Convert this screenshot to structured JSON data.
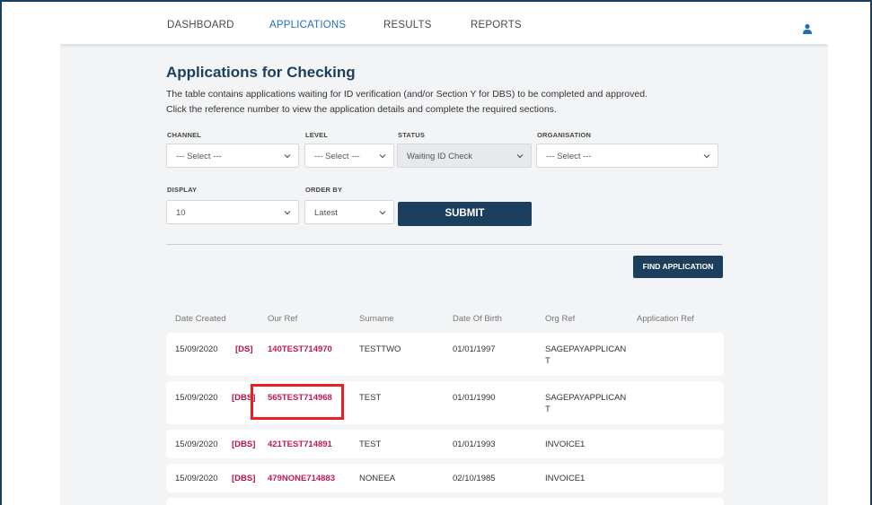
{
  "nav": {
    "items": [
      "DASHBOARD",
      "APPLICATIONS",
      "RESULTS",
      "REPORTS"
    ],
    "active": "APPLICATIONS"
  },
  "page": {
    "title": "Applications for Checking",
    "description_line1": "The table contains applications waiting for ID verification (and/or Section Y for DBS) to be completed and approved.",
    "description_line2": "Click the reference number to view the application details and complete the required sections."
  },
  "filters": {
    "channel": {
      "label": "CHANNEL",
      "value": "--- Select ---"
    },
    "level": {
      "label": "LEVEL",
      "value": "--- Select ---"
    },
    "status": {
      "label": "STATUS",
      "value": "Waiting ID Check"
    },
    "organisation": {
      "label": "ORGANISATION",
      "value": "--- Select ---"
    },
    "display": {
      "label": "DISPLAY",
      "value": "10"
    },
    "order_by": {
      "label": "ORDER BY",
      "value": "Latest"
    },
    "submit_label": "SUBMIT"
  },
  "find_application_label": "FIND APPLICATION",
  "table": {
    "headers": [
      "Date Created",
      "Our Ref",
      "Surname",
      "Date Of Birth",
      "Org Ref",
      "Application Ref"
    ],
    "rows": [
      {
        "date": "15/09/2020",
        "type": "[DS]",
        "ref": "140TEST714970",
        "surname": "TESTTWO",
        "dob": "01/01/1997",
        "org_ref_line1": "SAGEPAYAPPLICAN",
        "org_ref_line2": "T",
        "app_ref": ""
      },
      {
        "date": "15/09/2020",
        "type": "[DBS]",
        "ref": "565TEST714968",
        "surname": "TEST",
        "dob": "01/01/1990",
        "org_ref_line1": "SAGEPAYAPPLICAN",
        "org_ref_line2": "T",
        "app_ref": ""
      },
      {
        "date": "15/09/2020",
        "type": "[DBS]",
        "ref": "421TEST714891",
        "surname": "TEST",
        "dob": "01/01/1993",
        "org_ref_line1": "INVOICE1",
        "org_ref_line2": "",
        "app_ref": ""
      },
      {
        "date": "15/09/2020",
        "type": "[DBS]",
        "ref": "479NONE714883",
        "surname": "NONEEA",
        "dob": "02/10/1985",
        "org_ref_line1": "INVOICE1",
        "org_ref_line2": "",
        "app_ref": ""
      }
    ]
  },
  "colors": {
    "brand_navy": "#1d3f5e",
    "nav_active": "#1b70b8",
    "ref_link": "#c2185b",
    "highlight_box": "#e8201f"
  },
  "icons": {
    "user": "user-icon",
    "chevron": "chevron-down-icon"
  }
}
